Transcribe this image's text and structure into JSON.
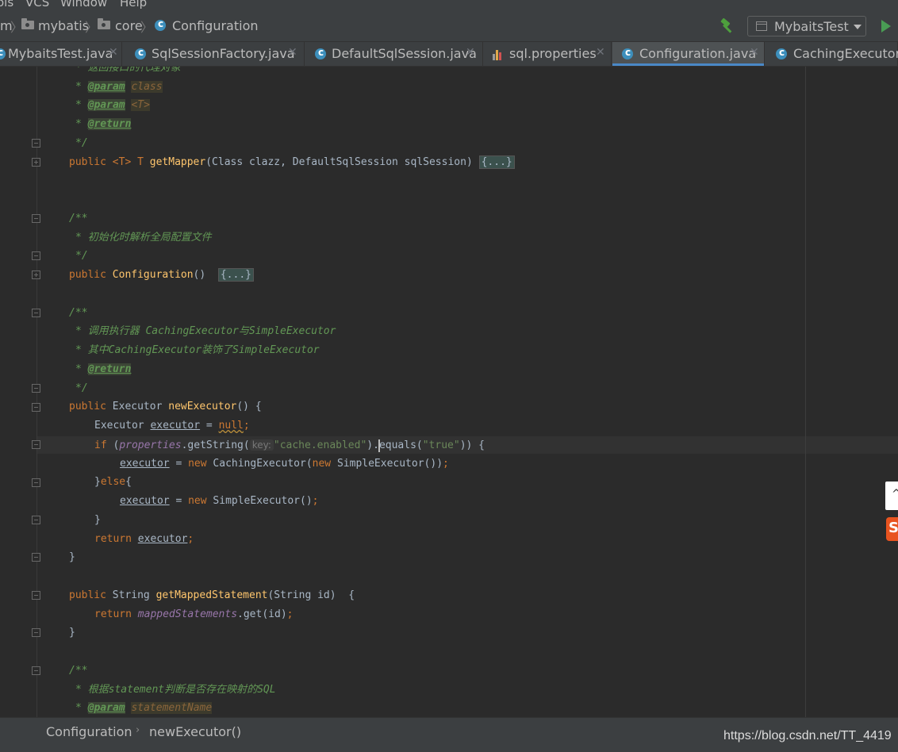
{
  "menubar": {
    "items": [
      "ols",
      "VCS",
      "Window",
      "Help"
    ]
  },
  "navbar": {
    "crumbs": [
      "m",
      "mybatis",
      "core",
      "Configuration"
    ],
    "run_config": "MybaitsTest"
  },
  "tabs": [
    {
      "label": "MybaitsTest.java",
      "active": false
    },
    {
      "label": "SqlSessionFactory.java",
      "active": false
    },
    {
      "label": "DefaultSqlSession.java",
      "active": false
    },
    {
      "label": "sql.properties",
      "active": false
    },
    {
      "label": "Configuration.java",
      "active": true
    },
    {
      "label": "CachingExecutor.ja",
      "active": false
    }
  ],
  "editor": {
    "lines": {
      "l1_doc": "* 返回接口的代理对象",
      "l2_tag": "@param",
      "l2_arg": "class",
      "l3_tag": "@param",
      "l3_arg": "<T>",
      "l4_tag": "@return",
      "l5": "*/",
      "l6_kw": "public",
      "l6_gen": "<T> T",
      "l6_name": "getMapper",
      "l6_sig": "(Class clazz, DefaultSqlSession sqlSession)",
      "l6_fold": "{...}",
      "l7": "/**",
      "l8": "* 初始化时解析全局配置文件",
      "l9": "*/",
      "l10_kw": "public",
      "l10_name": "Configuration",
      "l10_sig": "()",
      "l10_fold": "{...}",
      "l11": "/**",
      "l12": "* 调用执行器 CachingExecutor与SimpleExecutor",
      "l13": "* 其中CachingExecutor装饰了SimpleExecutor",
      "l14_tag": "@return",
      "l15": "*/",
      "l16_kw": "public",
      "l16_type": "Executor",
      "l16_name": "newExecutor",
      "l16_tail": "() {",
      "l17_type": "Executor",
      "l17_var": "executor",
      "l17_eq": " = ",
      "l17_null": "null",
      "l17_semi": ";",
      "l18_if": "if",
      "l18_open": " (",
      "l18_field": "properties",
      "l18_call": ".getString(",
      "l18_hint": "key:",
      "l18_str": "\"cache.enabled\"",
      "l18_mid": ").",
      "l18_eq_a": "e",
      "l18_eq_b": "quals(",
      "l18_str2": "\"true\"",
      "l18_end": ")) {",
      "l19_var": "executor",
      "l19_eq": " = ",
      "l19_new": "new",
      "l19_cls": " CachingExecutor(",
      "l19_new2": "new",
      "l19_cls2": " SimpleExecutor())",
      "l19_semi": ";",
      "l20_brace": "}",
      "l20_else": "else",
      "l20_open": "{",
      "l21_var": "executor",
      "l21_eq": " = ",
      "l21_new": "new",
      "l21_cls": " SimpleExecutor()",
      "l21_semi": ";",
      "l22": "}",
      "l23_ret": "return",
      "l23_var": "executor",
      "l23_semi": ";",
      "l24": "}",
      "l25_kw": "public",
      "l25_type": "String",
      "l25_name": "getMappedStatement",
      "l25_sig": "(String id)  {",
      "l26_ret": "return",
      "l26_field": "mappedStatements",
      "l26_call": ".get(id)",
      "l26_semi": ";",
      "l27": "}",
      "l28": "/**",
      "l29": "* 根据statement判断是否存在映射的SQL",
      "l30_tag": "@param",
      "l30_arg": "statementName"
    }
  },
  "statusbar": {
    "crumb1": "Configuration",
    "crumb2": "newExecutor()",
    "watermark": "https://blog.csdn.net/TT_4419"
  },
  "colors": {
    "background": "#2b2b2b",
    "keyword": "#cc7832",
    "method": "#ffc66d",
    "doc_comment": "#629755",
    "string": "#6a8759",
    "field": "#9876aa",
    "active_tab_underline": "#4a88c7"
  }
}
